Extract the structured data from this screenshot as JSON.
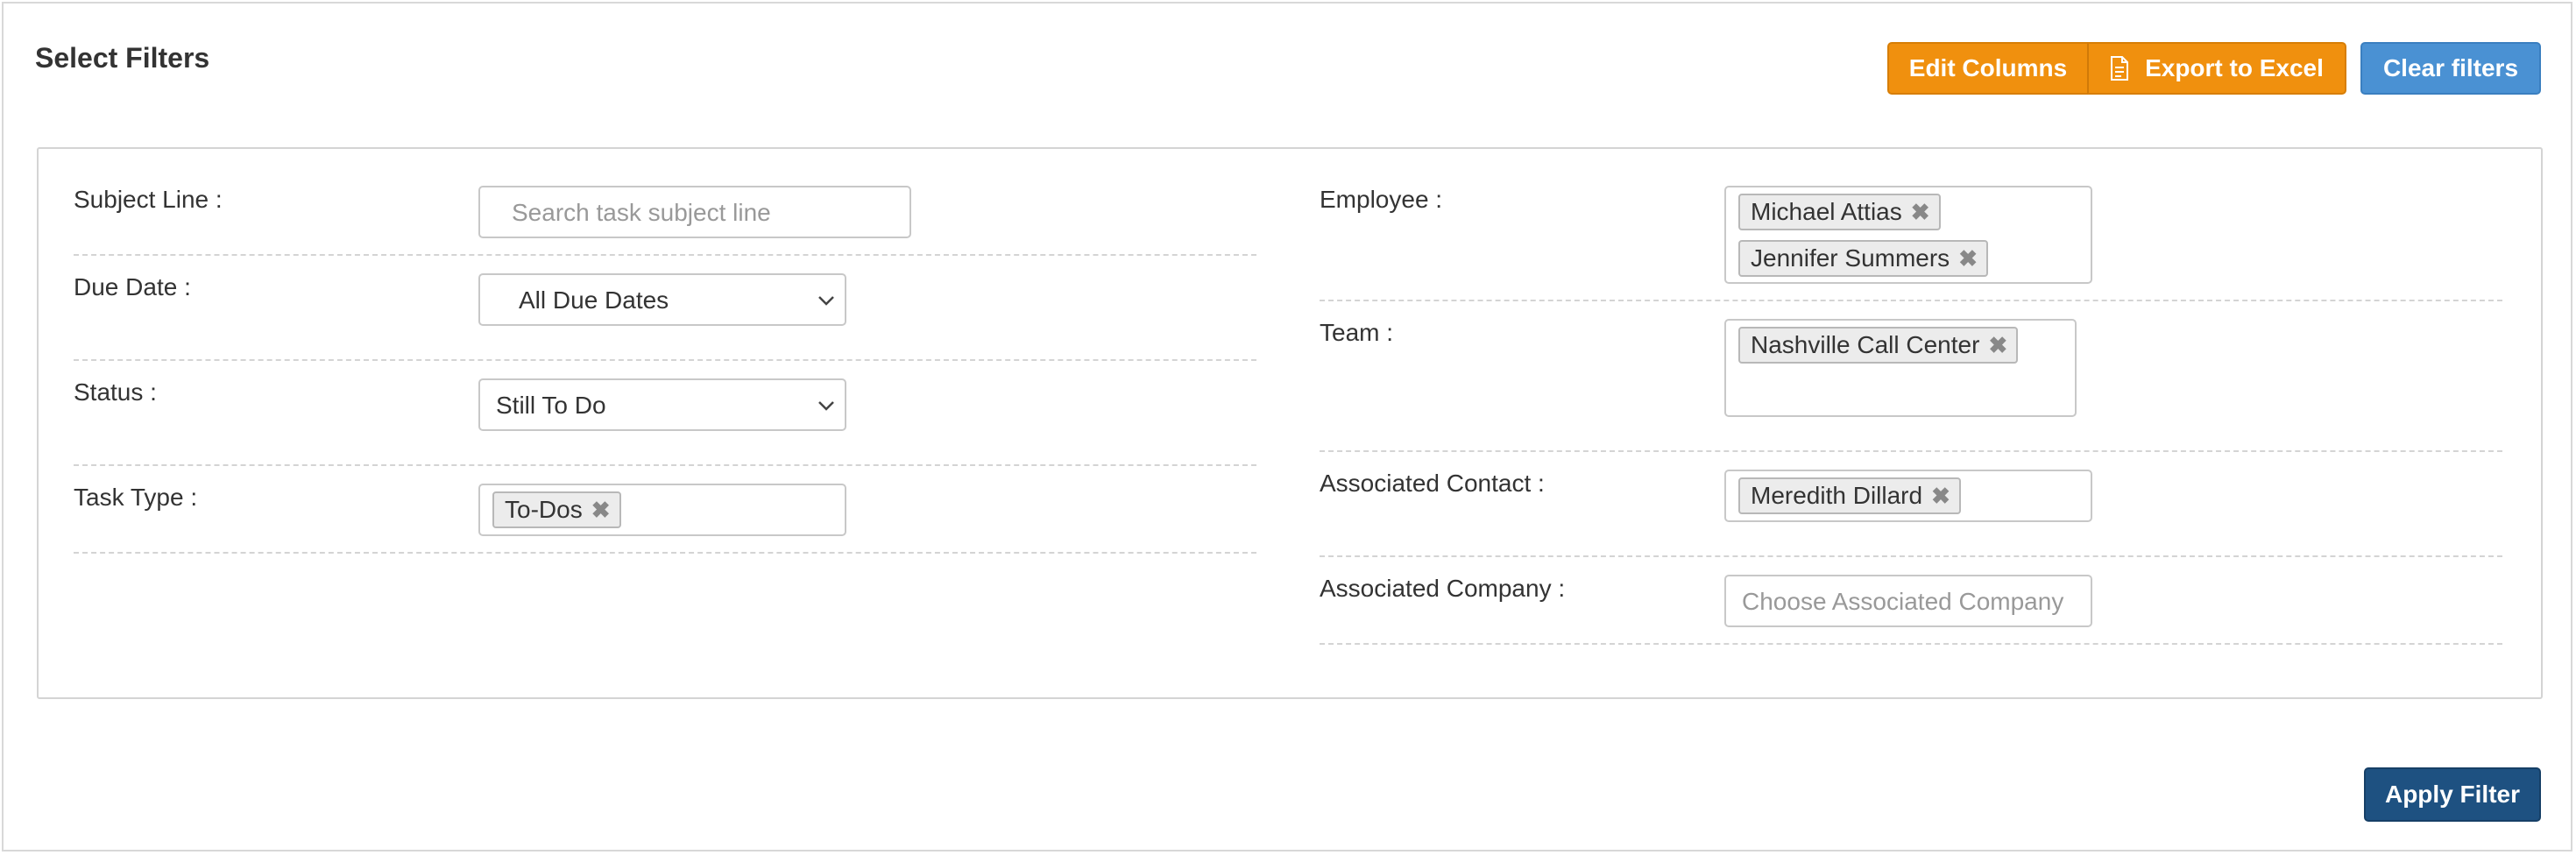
{
  "header": {
    "title": "Select Filters",
    "edit_columns_label": "Edit Columns",
    "export_label": "Export to Excel",
    "clear_filters_label": "Clear filters"
  },
  "filters_left": {
    "subject_line": {
      "label": "Subject Line :",
      "placeholder": "Search task subject line"
    },
    "due_date": {
      "label": "Due Date :",
      "value": "All Due Dates"
    },
    "status": {
      "label": "Status :",
      "value": "Still To Do"
    },
    "task_type": {
      "label": "Task Type :",
      "tags": [
        "To-Dos"
      ]
    }
  },
  "filters_right": {
    "employee": {
      "label": "Employee :",
      "tags": [
        "Michael Attias",
        "Jennifer Summers"
      ]
    },
    "team": {
      "label": "Team :",
      "tags": [
        "Nashville Call Center"
      ]
    },
    "associated_contact": {
      "label": "Associated Contact :",
      "tags": [
        "Meredith Dillard"
      ]
    },
    "associated_company": {
      "label": "Associated Company :",
      "placeholder": "Choose Associated Company"
    }
  },
  "footer": {
    "apply_label": "Apply Filter"
  },
  "icons": {
    "export": "document-icon",
    "remove_tag": "close-icon",
    "select": "chevron-down-icon"
  },
  "colors": {
    "orange": "#f0900e",
    "blue": "#4a91d3",
    "dark_blue": "#1e5181"
  },
  "tag_remove_glyph": "✖"
}
